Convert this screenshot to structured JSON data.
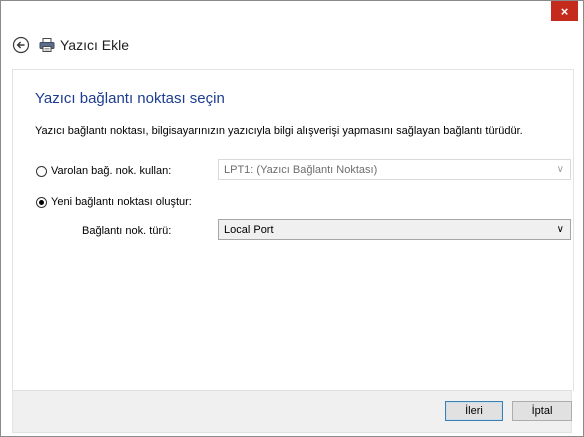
{
  "window": {
    "close_glyph": "×",
    "title": "Yazıcı Ekle"
  },
  "page": {
    "heading": "Yazıcı bağlantı noktası seçin",
    "description": "Yazıcı bağlantı noktası, bilgisayarınızın yazıcıyla bilgi alışverişi yapmasını sağlayan bağlantı türüdür."
  },
  "options": {
    "existing_port_label": "Varolan bağ. nok. kullan:",
    "existing_port_value": "LPT1: (Yazıcı Bağlantı Noktası)",
    "new_port_label": "Yeni bağlantı noktası oluştur:",
    "port_type_label": "Bağlantı nok. türü:",
    "port_type_value": "Local Port"
  },
  "footer": {
    "next_label": "İleri",
    "cancel_label": "İptal"
  },
  "colors": {
    "heading": "#1c3d8f",
    "close_button": "#c42b1c"
  },
  "icons": [
    "close-icon",
    "back-arrow-icon",
    "printer-icon",
    "chevron-down-icon"
  ]
}
